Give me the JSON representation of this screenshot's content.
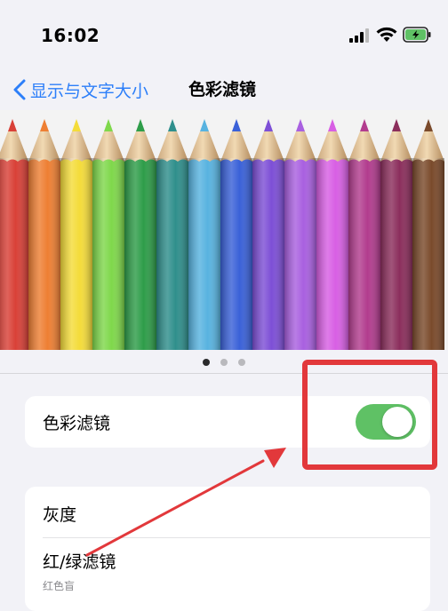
{
  "status_bar": {
    "time": "16:02"
  },
  "nav": {
    "back_label": "显示与文字大小",
    "title": "色彩滤镜"
  },
  "banner": {
    "pencil_colors": [
      "#d94037",
      "#ee7f33",
      "#f4dc3a",
      "#7fd84b",
      "#2e9d49",
      "#2f8f8c",
      "#58b3e0",
      "#3a61d8",
      "#7d4fd6",
      "#a960e0",
      "#d85fe4",
      "#b23c8e",
      "#8b2e5c",
      "#7a4a2b"
    ],
    "page_count": 3,
    "active_page": 0
  },
  "toggle_row": {
    "label": "色彩滤镜",
    "enabled": true,
    "on_color": "#5fc165"
  },
  "filters": [
    {
      "label": "灰度",
      "sublabel": ""
    },
    {
      "label": "红/绿滤镜",
      "sublabel": "红色盲"
    }
  ],
  "annotation": {
    "color": "#e2383b"
  }
}
